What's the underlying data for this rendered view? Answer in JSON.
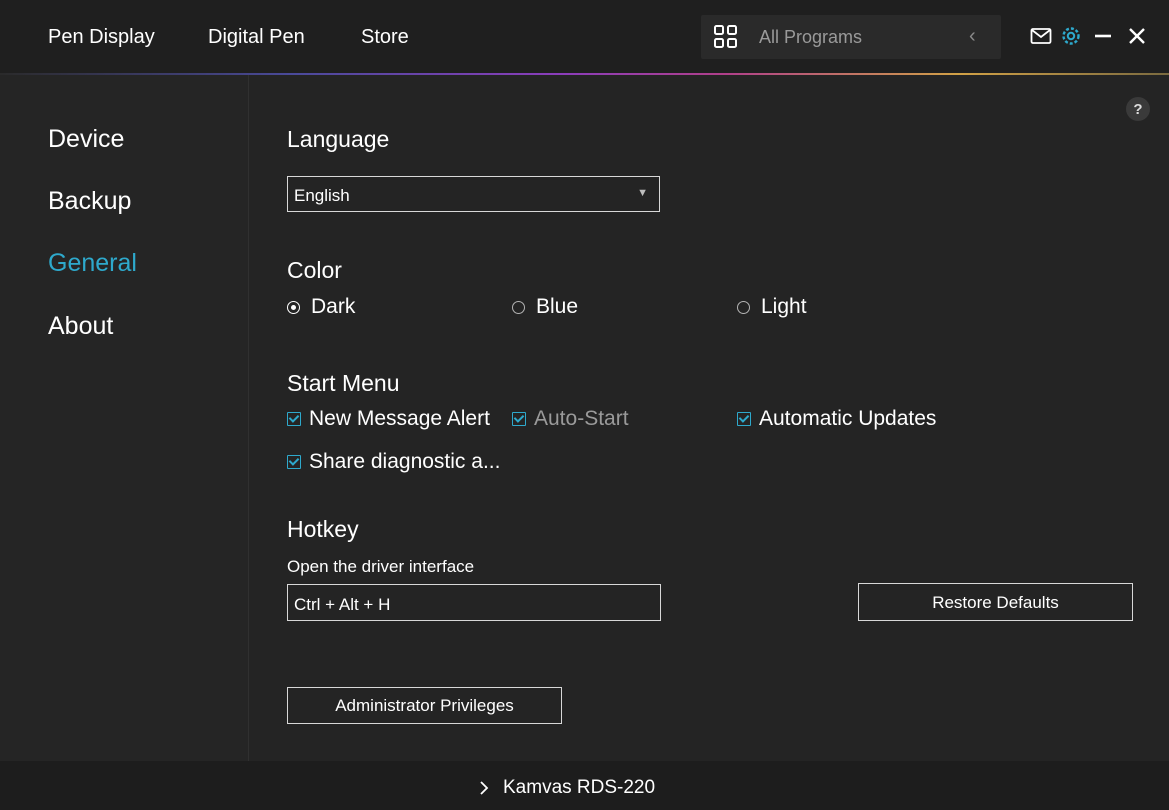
{
  "header": {
    "tabs": [
      {
        "label": "Pen Display"
      },
      {
        "label": "Digital Pen"
      },
      {
        "label": "Store"
      }
    ],
    "program_selector": {
      "placeholder": "All Programs",
      "arrow": "‹"
    },
    "icons": [
      "grid-icon",
      "mail-icon",
      "settings-icon",
      "minimize-icon",
      "close-icon"
    ],
    "accent": "#2ea9cc"
  },
  "sidebar": {
    "items": [
      {
        "label": "Device"
      },
      {
        "label": "Backup"
      },
      {
        "label": "General"
      },
      {
        "label": "About"
      }
    ],
    "active_label": "General"
  },
  "main": {
    "language": {
      "title": "Language",
      "value": "English",
      "options": [
        "English"
      ]
    },
    "color": {
      "title": "Color",
      "options": [
        {
          "label": "Dark",
          "selected": true
        },
        {
          "label": "Blue",
          "selected": false
        },
        {
          "label": "Light",
          "selected": false
        }
      ]
    },
    "start_menu": {
      "title": "Start Menu",
      "options": [
        {
          "label": "New Message Alert",
          "checked": true
        },
        {
          "label": "Auto-Start",
          "checked": true
        },
        {
          "label": "Automatic Updates",
          "checked": true
        },
        {
          "label": "Share diagnostic a...",
          "checked": true
        }
      ]
    },
    "hotkey": {
      "title": "Hotkey",
      "label": "Open the driver interface",
      "value": "Ctrl + Alt + H",
      "restore_label": "Restore Defaults"
    },
    "admin_label": "Administrator Privileges",
    "help": "?"
  },
  "footer": {
    "chevron": "›",
    "device": "Kamvas RDS-220"
  }
}
